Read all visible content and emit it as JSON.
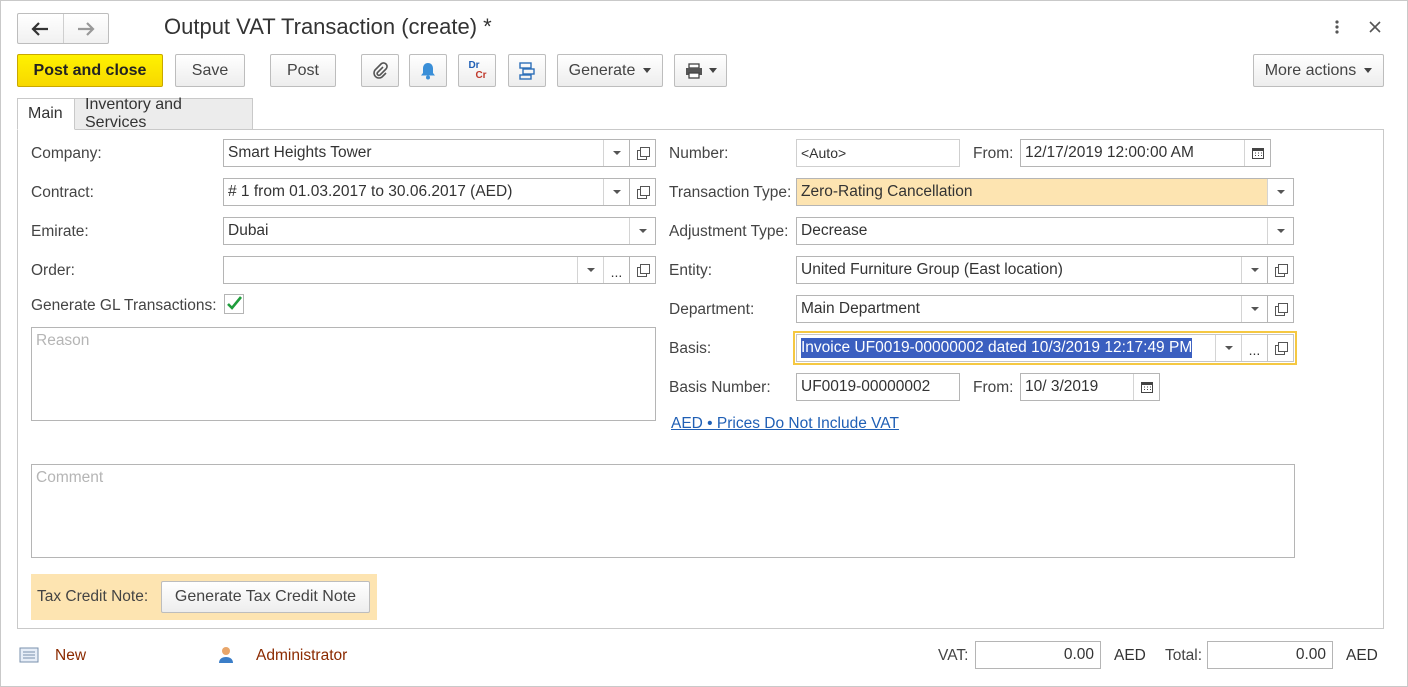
{
  "window": {
    "title": "Output VAT Transaction (create) *"
  },
  "toolbar": {
    "post_close": "Post and close",
    "save": "Save",
    "post": "Post",
    "generate": "Generate",
    "more_actions": "More actions",
    "drcr_top": "Dr",
    "drcr_bottom": "Cr"
  },
  "tabs": [
    {
      "label": "Main",
      "active": true
    },
    {
      "label": "Inventory and Services",
      "active": false
    }
  ],
  "left": {
    "company_label": "Company:",
    "company_value": "Smart Heights Tower",
    "contract_label": "Contract:",
    "contract_value": "# 1 from 01.03.2017 to 30.06.2017 (AED)",
    "emirate_label": "Emirate:",
    "emirate_value": "Dubai",
    "order_label": "Order:",
    "order_value": "",
    "gl_label": "Generate GL Transactions:",
    "gl_checked": true,
    "reason_placeholder": "Reason"
  },
  "right": {
    "number_label": "Number:",
    "number_placeholder": "<Auto>",
    "from_label": "From:",
    "from_value": "12/17/2019 12:00:00 AM",
    "transaction_type_label": "Transaction Type:",
    "transaction_type_value": "Zero-Rating Cancellation",
    "adjustment_type_label": "Adjustment Type:",
    "adjustment_type_value": "Decrease",
    "entity_label": "Entity:",
    "entity_value": "United Furniture Group (East location)",
    "department_label": "Department:",
    "department_value": "Main Department",
    "basis_label": "Basis:",
    "basis_value": "Invoice UF0019-00000002 dated 10/3/2019 12:17:49 PM",
    "basis_number_label": "Basis Number:",
    "basis_number_value": "UF0019-00000002",
    "basis_from_label": "From:",
    "basis_from_value": "10/ 3/2019",
    "prices_link": "AED • Prices Do Not Include VAT"
  },
  "comment_placeholder": "Comment",
  "tax_credit": {
    "label": "Tax Credit Note:",
    "button": "Generate Tax Credit Note"
  },
  "footer": {
    "status": "New",
    "user": "Administrator",
    "vat_label": "VAT:",
    "vat_value": "0.00",
    "vat_currency": "AED",
    "total_label": "Total:",
    "total_value": "0.00",
    "total_currency": "AED"
  },
  "colors": {
    "primary_button": "#f7d800",
    "highlight_field": "#fde4b1",
    "tax_credit_bg": "#fde4b1",
    "selection": "#3b5fc0",
    "focus_border": "#f5c842",
    "link": "#1f5fb5",
    "status_text": "#8b2a00",
    "check": "#1f9d3c"
  },
  "icons": [
    "back-arrow-icon",
    "forward-arrow-icon",
    "kebab-menu-icon",
    "close-icon",
    "paperclip-icon",
    "bell-icon",
    "drcr-icon",
    "structure-icon",
    "printer-icon",
    "calendar-icon",
    "document-icon",
    "user-icon",
    "checkmark-icon"
  ]
}
